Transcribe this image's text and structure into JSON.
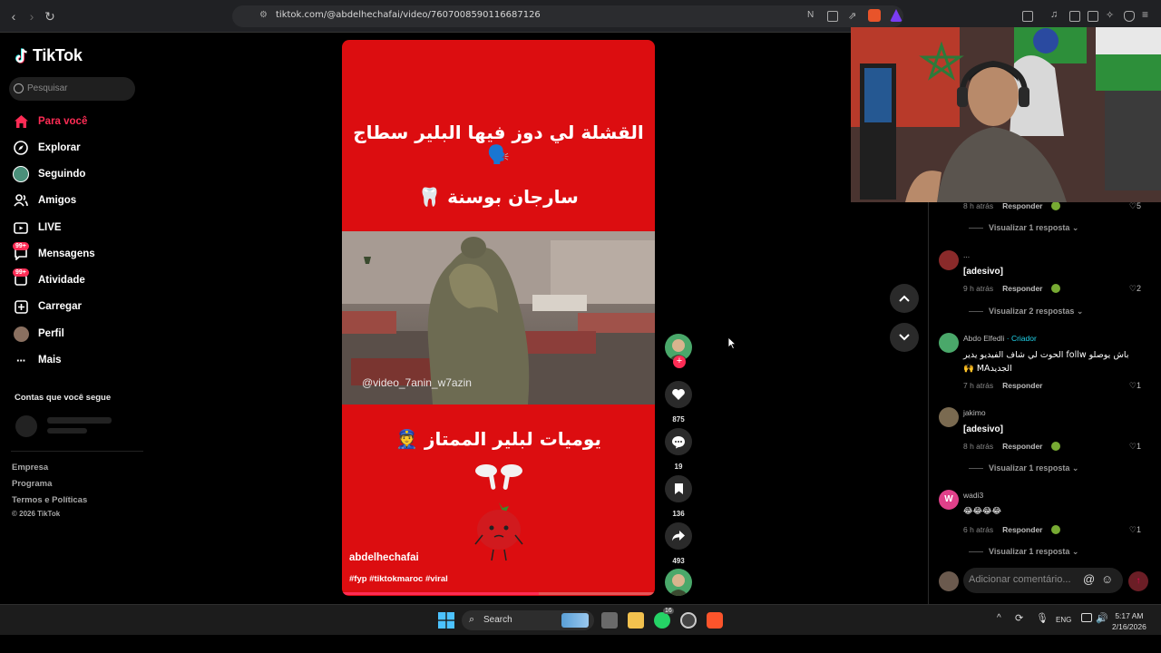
{
  "browser": {
    "url": "tiktok.com/@abdelhechafai/video/7607008590116687126"
  },
  "sidebar": {
    "logo": "TikTok",
    "search_placeholder": "Pesquisar",
    "items": [
      {
        "label": "Para você",
        "icon": "home-icon",
        "active": true
      },
      {
        "label": "Explorar",
        "icon": "compass-icon"
      },
      {
        "label": "Seguindo",
        "icon": "following-avatar-icon"
      },
      {
        "label": "Amigos",
        "icon": "friends-icon"
      },
      {
        "label": "LIVE",
        "icon": "live-icon"
      },
      {
        "label": "Mensagens",
        "icon": "messages-icon",
        "badge": "99+"
      },
      {
        "label": "Atividade",
        "icon": "activity-icon",
        "badge": "99+"
      },
      {
        "label": "Carregar",
        "icon": "upload-icon"
      },
      {
        "label": "Perfil",
        "icon": "profile-avatar-icon"
      },
      {
        "label": "Mais",
        "icon": "more-icon"
      }
    ],
    "following_title": "Contas que você segue",
    "footer": [
      "Empresa",
      "Programa",
      "Termos e Políticas"
    ],
    "copyright": "© 2026 TikTok"
  },
  "video": {
    "line1": "القشلة لي دوز فيها البلير سطاج 🗣️",
    "line2": "سارجان بوسنة 🦷",
    "watermark": "@video_7anin_w7azin",
    "line3": "يوميات لبلير الممتاز 👮",
    "author": "abdelhechafai",
    "tags": "#fyp #tiktokmaroc #viral",
    "progress": 0.63,
    "background_color": "#dc0d10"
  },
  "actions": {
    "likes": "875",
    "comments": "19",
    "saves": "136",
    "shares": "493"
  },
  "comments": [
    {
      "time": "8 h atrás",
      "reply": "Responder",
      "likes": "5",
      "view_replies": "Visualizar 1 resposta"
    },
    {
      "name": "...",
      "text": "[adesivo]",
      "time": "9 h atrás",
      "reply": "Responder",
      "likes": "2",
      "view_replies": "Visualizar 2 respostas"
    },
    {
      "name": "Abdo Elfedli",
      "creator": "· Criador",
      "text_line1": "باش يوصلو follw الحوت لي شاف الفيديو يدير",
      "text_line2": "الجديدMA 🙌",
      "time": "7 h atrás",
      "reply": "Responder",
      "likes": "1"
    },
    {
      "name": "jakimo",
      "text": "[adesivo]",
      "time": "8 h atrás",
      "reply": "Responder",
      "likes": "1",
      "view_replies": "Visualizar 1 resposta"
    },
    {
      "name": "wadi3",
      "avatar_letter": "W",
      "text": "😂😂😂😂",
      "time": "6 h atrás",
      "reply": "Responder",
      "likes": "1",
      "view_replies": "Visualizar 1 resposta"
    }
  ],
  "comment_input_placeholder": "Adicionar comentário...",
  "taskbar": {
    "search_label": "Search",
    "lang": "ENG",
    "time": "5:17 AM",
    "date": "2/16/2026",
    "whatsapp_badge": "16"
  },
  "colors": {
    "accent": "#fe2c55",
    "creator": "#20d5ec"
  }
}
